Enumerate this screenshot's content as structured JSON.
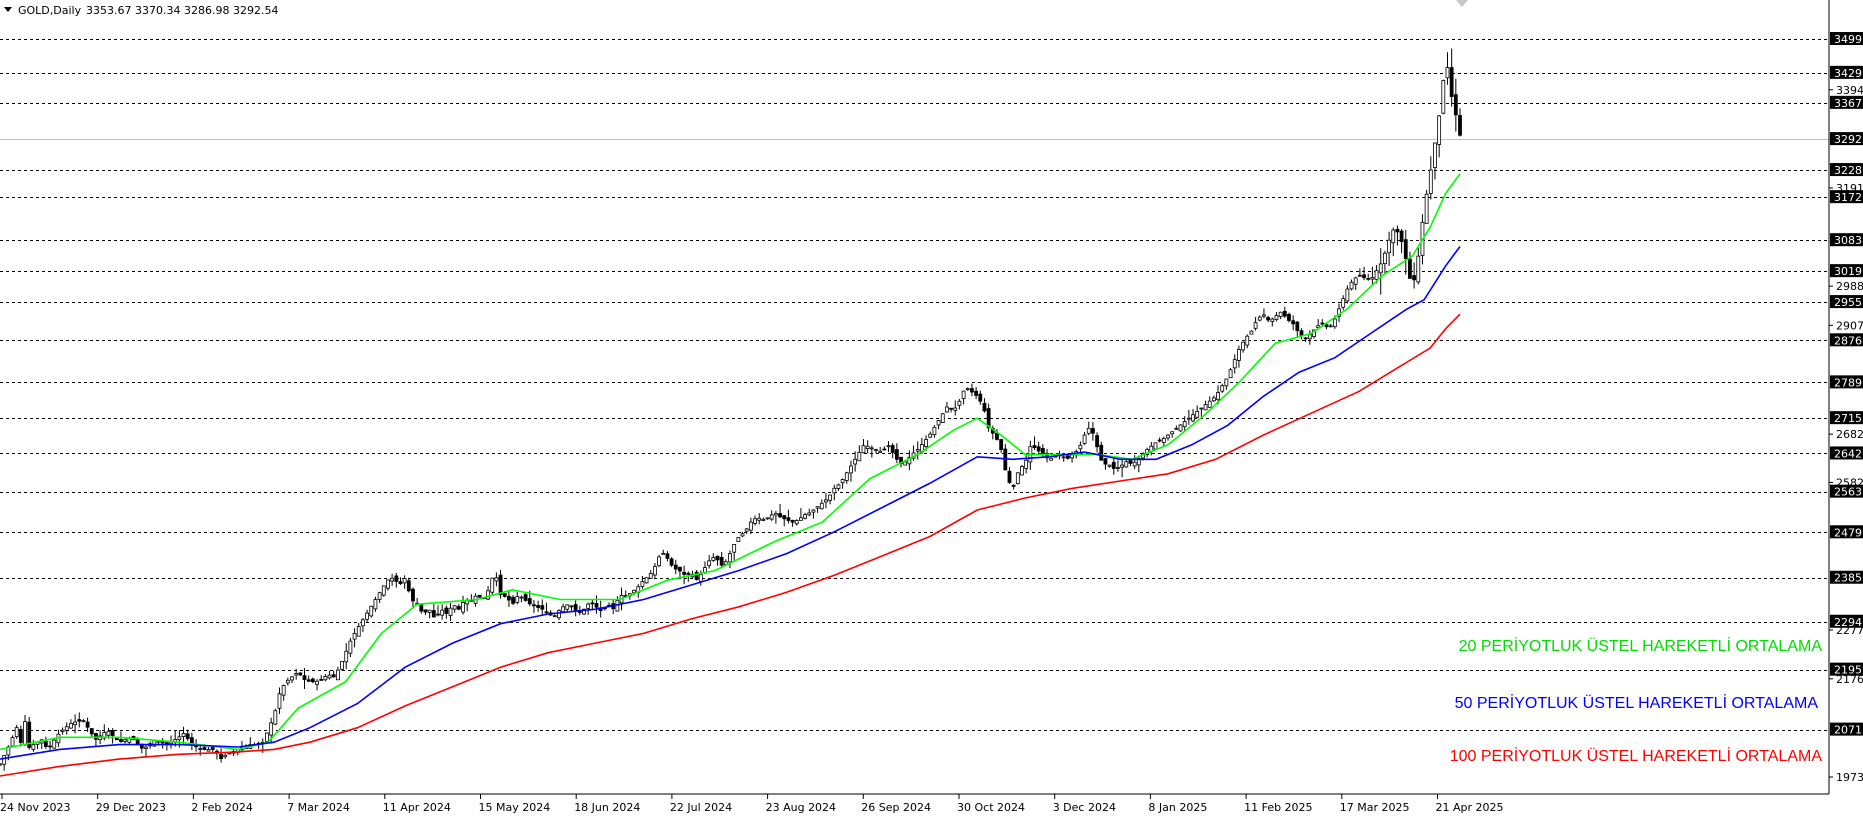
{
  "header": {
    "symbol": "GOLD,Daily",
    "ohlc": "3353.67 3370.34 3286.98 3292.54"
  },
  "chart_data": {
    "type": "candlestick",
    "title": "GOLD,Daily",
    "ylim": [
      1940,
      3510
    ],
    "price_axis_ticks": [
      "3499",
      "3429",
      "3394",
      "3367",
      "3292",
      "3228",
      "3191",
      "3172",
      "3083",
      "3019",
      "2988",
      "2955",
      "2907",
      "2876",
      "2789",
      "2715",
      "2682",
      "2642",
      "2582",
      "2563",
      "2479",
      "2385",
      "2294",
      "2277",
      "2195",
      "2176",
      "2071",
      "1973"
    ],
    "highlighted_levels": [
      "3499",
      "3429",
      "3367",
      "3292",
      "3228",
      "3172",
      "3083",
      "3019",
      "2955",
      "2876",
      "2789",
      "2715",
      "2642",
      "2563",
      "2479",
      "2385",
      "2294",
      "2195",
      "2071"
    ],
    "current_price": "3292",
    "x_tick_labels": [
      "24 Nov 2023",
      "29 Dec 2023",
      "2 Feb 2024",
      "7 Mar 2024",
      "11 Apr 2024",
      "15 May 2024",
      "18 Jun 2024",
      "22 Jul 2024",
      "23 Aug 2024",
      "26 Sep 2024",
      "30 Oct 2024",
      "3 Dec 2024",
      "8 Jan 2025",
      "11 Feb 2025",
      "17 Mar 2025",
      "21 Apr 2025"
    ],
    "price_path": [
      [
        0,
        2000
      ],
      [
        8,
        2040
      ],
      [
        14,
        2075
      ],
      [
        18,
        2040
      ],
      [
        20,
        2145
      ],
      [
        22,
        2030
      ],
      [
        28,
        2040
      ],
      [
        35,
        2050
      ],
      [
        40,
        2030
      ],
      [
        50,
        2065
      ],
      [
        60,
        2085
      ],
      [
        70,
        2090
      ],
      [
        80,
        2050
      ],
      [
        90,
        2070
      ],
      [
        100,
        2045
      ],
      [
        110,
        2055
      ],
      [
        120,
        2030
      ],
      [
        130,
        2050
      ],
      [
        140,
        2040
      ],
      [
        150,
        2055
      ],
      [
        155,
        2065
      ],
      [
        160,
        2040
      ],
      [
        170,
        2030
      ],
      [
        180,
        2030
      ],
      [
        185,
        2010
      ],
      [
        190,
        2020
      ],
      [
        200,
        2030
      ],
      [
        210,
        2040
      ],
      [
        220,
        2040
      ],
      [
        225,
        2070
      ],
      [
        230,
        2100
      ],
      [
        235,
        2150
      ],
      [
        240,
        2170
      ],
      [
        245,
        2180
      ],
      [
        250,
        2190
      ],
      [
        255,
        2175
      ],
      [
        260,
        2170
      ],
      [
        265,
        2170
      ],
      [
        270,
        2175
      ],
      [
        275,
        2185
      ],
      [
        280,
        2180
      ],
      [
        285,
        2200
      ],
      [
        290,
        2230
      ],
      [
        295,
        2260
      ],
      [
        300,
        2280
      ],
      [
        305,
        2300
      ],
      [
        310,
        2320
      ],
      [
        315,
        2340
      ],
      [
        320,
        2360
      ],
      [
        325,
        2380
      ],
      [
        330,
        2385
      ],
      [
        335,
        2370
      ],
      [
        340,
        2385
      ],
      [
        345,
        2340
      ],
      [
        350,
        2330
      ],
      [
        355,
        2310
      ],
      [
        360,
        2320
      ],
      [
        365,
        2300
      ],
      [
        370,
        2320
      ],
      [
        375,
        2310
      ],
      [
        380,
        2330
      ],
      [
        385,
        2320
      ],
      [
        390,
        2340
      ],
      [
        395,
        2335
      ],
      [
        400,
        2350
      ],
      [
        405,
        2340
      ],
      [
        410,
        2360
      ],
      [
        415,
        2400
      ],
      [
        420,
        2350
      ],
      [
        425,
        2345
      ],
      [
        430,
        2330
      ],
      [
        435,
        2350
      ],
      [
        440,
        2340
      ],
      [
        445,
        2330
      ],
      [
        450,
        2325
      ],
      [
        455,
        2320
      ],
      [
        460,
        2310
      ],
      [
        465,
        2305
      ],
      [
        470,
        2320
      ],
      [
        475,
        2330
      ],
      [
        480,
        2325
      ],
      [
        485,
        2310
      ],
      [
        490,
        2320
      ],
      [
        495,
        2335
      ],
      [
        500,
        2325
      ],
      [
        505,
        2315
      ],
      [
        510,
        2330
      ],
      [
        515,
        2320
      ],
      [
        520,
        2350
      ],
      [
        525,
        2345
      ],
      [
        530,
        2355
      ],
      [
        535,
        2365
      ],
      [
        540,
        2380
      ],
      [
        545,
        2390
      ],
      [
        550,
        2410
      ],
      [
        555,
        2440
      ],
      [
        560,
        2425
      ],
      [
        565,
        2405
      ],
      [
        570,
        2400
      ],
      [
        575,
        2390
      ],
      [
        580,
        2395
      ],
      [
        585,
        2380
      ],
      [
        590,
        2400
      ],
      [
        595,
        2420
      ],
      [
        600,
        2430
      ],
      [
        605,
        2410
      ],
      [
        610,
        2420
      ],
      [
        615,
        2450
      ],
      [
        620,
        2470
      ],
      [
        625,
        2480
      ],
      [
        630,
        2500
      ],
      [
        635,
        2510
      ],
      [
        640,
        2505
      ],
      [
        645,
        2510
      ],
      [
        650,
        2520
      ],
      [
        655,
        2510
      ],
      [
        660,
        2505
      ],
      [
        665,
        2500
      ],
      [
        670,
        2505
      ],
      [
        675,
        2515
      ],
      [
        680,
        2520
      ],
      [
        685,
        2530
      ],
      [
        690,
        2540
      ],
      [
        695,
        2550
      ],
      [
        700,
        2570
      ],
      [
        705,
        2580
      ],
      [
        710,
        2600
      ],
      [
        715,
        2620
      ],
      [
        720,
        2640
      ],
      [
        725,
        2660
      ],
      [
        730,
        2655
      ],
      [
        735,
        2650
      ],
      [
        740,
        2645
      ],
      [
        745,
        2660
      ],
      [
        750,
        2640
      ],
      [
        755,
        2620
      ],
      [
        760,
        2625
      ],
      [
        765,
        2640
      ],
      [
        770,
        2650
      ],
      [
        775,
        2665
      ],
      [
        780,
        2680
      ],
      [
        785,
        2700
      ],
      [
        790,
        2720
      ],
      [
        795,
        2740
      ],
      [
        800,
        2730
      ],
      [
        805,
        2750
      ],
      [
        810,
        2780
      ],
      [
        815,
        2770
      ],
      [
        820,
        2760
      ],
      [
        825,
        2740
      ],
      [
        830,
        2690
      ],
      [
        835,
        2680
      ],
      [
        840,
        2650
      ],
      [
        845,
        2590
      ],
      [
        850,
        2570
      ],
      [
        855,
        2610
      ],
      [
        860,
        2620
      ],
      [
        865,
        2660
      ],
      [
        870,
        2650
      ],
      [
        875,
        2640
      ],
      [
        880,
        2630
      ],
      [
        885,
        2635
      ],
      [
        890,
        2640
      ],
      [
        895,
        2630
      ],
      [
        900,
        2640
      ],
      [
        905,
        2650
      ],
      [
        910,
        2680
      ],
      [
        915,
        2700
      ],
      [
        920,
        2660
      ],
      [
        925,
        2620
      ],
      [
        930,
        2620
      ],
      [
        935,
        2610
      ],
      [
        940,
        2615
      ],
      [
        945,
        2625
      ],
      [
        950,
        2620
      ],
      [
        955,
        2630
      ],
      [
        960,
        2645
      ],
      [
        965,
        2655
      ],
      [
        970,
        2665
      ],
      [
        975,
        2670
      ],
      [
        980,
        2680
      ],
      [
        985,
        2690
      ],
      [
        990,
        2700
      ],
      [
        995,
        2710
      ],
      [
        1000,
        2720
      ],
      [
        1005,
        2730
      ],
      [
        1010,
        2740
      ],
      [
        1015,
        2750
      ],
      [
        1020,
        2760
      ],
      [
        1025,
        2780
      ],
      [
        1030,
        2800
      ],
      [
        1035,
        2830
      ],
      [
        1040,
        2860
      ],
      [
        1045,
        2880
      ],
      [
        1050,
        2895
      ],
      [
        1055,
        2920
      ],
      [
        1060,
        2930
      ],
      [
        1065,
        2915
      ],
      [
        1070,
        2925
      ],
      [
        1075,
        2935
      ],
      [
        1080,
        2920
      ],
      [
        1085,
        2910
      ],
      [
        1090,
        2890
      ],
      [
        1095,
        2880
      ],
      [
        1100,
        2890
      ],
      [
        1105,
        2905
      ],
      [
        1110,
        2910
      ],
      [
        1115,
        2900
      ],
      [
        1120,
        2920
      ],
      [
        1125,
        2950
      ],
      [
        1130,
        2980
      ],
      [
        1135,
        3000
      ],
      [
        1140,
        3010
      ],
      [
        1145,
        3005
      ],
      [
        1150,
        3000
      ],
      [
        1155,
        3020
      ],
      [
        1160,
        3040
      ],
      [
        1165,
        3080
      ],
      [
        1170,
        3110
      ],
      [
        1175,
        3090
      ],
      [
        1180,
        3040
      ],
      [
        1185,
        2980
      ],
      [
        1190,
        3050
      ],
      [
        1195,
        3150
      ],
      [
        1200,
        3220
      ],
      [
        1205,
        3300
      ],
      [
        1210,
        3380
      ],
      [
        1213,
        3480
      ],
      [
        1216,
        3400
      ],
      [
        1220,
        3360
      ],
      [
        1225,
        3300
      ]
    ],
    "ema_20_path": [
      [
        0,
        2030
      ],
      [
        50,
        2055
      ],
      [
        100,
        2055
      ],
      [
        150,
        2045
      ],
      [
        200,
        2030
      ],
      [
        225,
        2045
      ],
      [
        250,
        2115
      ],
      [
        290,
        2170
      ],
      [
        320,
        2270
      ],
      [
        350,
        2330
      ],
      [
        400,
        2340
      ],
      [
        430,
        2360
      ],
      [
        470,
        2340
      ],
      [
        520,
        2340
      ],
      [
        560,
        2380
      ],
      [
        600,
        2400
      ],
      [
        650,
        2460
      ],
      [
        690,
        2500
      ],
      [
        730,
        2590
      ],
      [
        770,
        2640
      ],
      [
        800,
        2690
      ],
      [
        820,
        2715
      ],
      [
        840,
        2680
      ],
      [
        860,
        2640
      ],
      [
        890,
        2640
      ],
      [
        920,
        2640
      ],
      [
        950,
        2630
      ],
      [
        980,
        2660
      ],
      [
        1010,
        2720
      ],
      [
        1040,
        2790
      ],
      [
        1070,
        2870
      ],
      [
        1100,
        2890
      ],
      [
        1130,
        2940
      ],
      [
        1160,
        3010
      ],
      [
        1185,
        3050
      ],
      [
        1200,
        3110
      ],
      [
        1213,
        3180
      ],
      [
        1225,
        3220
      ]
    ],
    "ema_50_path": [
      [
        0,
        2010
      ],
      [
        50,
        2030
      ],
      [
        100,
        2040
      ],
      [
        150,
        2040
      ],
      [
        200,
        2035
      ],
      [
        230,
        2045
      ],
      [
        260,
        2075
      ],
      [
        300,
        2125
      ],
      [
        340,
        2200
      ],
      [
        380,
        2250
      ],
      [
        420,
        2290
      ],
      [
        460,
        2310
      ],
      [
        500,
        2320
      ],
      [
        540,
        2340
      ],
      [
        580,
        2370
      ],
      [
        620,
        2400
      ],
      [
        660,
        2435
      ],
      [
        700,
        2480
      ],
      [
        740,
        2530
      ],
      [
        780,
        2580
      ],
      [
        820,
        2635
      ],
      [
        850,
        2630
      ],
      [
        880,
        2635
      ],
      [
        910,
        2645
      ],
      [
        940,
        2630
      ],
      [
        970,
        2630
      ],
      [
        1000,
        2660
      ],
      [
        1030,
        2700
      ],
      [
        1060,
        2760
      ],
      [
        1090,
        2810
      ],
      [
        1120,
        2840
      ],
      [
        1150,
        2890
      ],
      [
        1180,
        2940
      ],
      [
        1195,
        2960
      ],
      [
        1213,
        3030
      ],
      [
        1225,
        3070
      ]
    ],
    "ema_100_path": [
      [
        0,
        1975
      ],
      [
        50,
        1995
      ],
      [
        100,
        2010
      ],
      [
        150,
        2020
      ],
      [
        200,
        2025
      ],
      [
        230,
        2030
      ],
      [
        260,
        2045
      ],
      [
        300,
        2075
      ],
      [
        340,
        2120
      ],
      [
        380,
        2160
      ],
      [
        420,
        2200
      ],
      [
        460,
        2230
      ],
      [
        500,
        2250
      ],
      [
        540,
        2270
      ],
      [
        580,
        2300
      ],
      [
        620,
        2325
      ],
      [
        660,
        2355
      ],
      [
        700,
        2390
      ],
      [
        740,
        2430
      ],
      [
        780,
        2470
      ],
      [
        820,
        2525
      ],
      [
        860,
        2550
      ],
      [
        900,
        2570
      ],
      [
        940,
        2585
      ],
      [
        980,
        2600
      ],
      [
        1020,
        2630
      ],
      [
        1060,
        2680
      ],
      [
        1100,
        2725
      ],
      [
        1140,
        2770
      ],
      [
        1180,
        2830
      ],
      [
        1200,
        2860
      ],
      [
        1213,
        2900
      ],
      [
        1225,
        2930
      ]
    ],
    "series": [
      {
        "name": "20 PERİYOTLUK ÜSTEL HAREKETLİ ORTALAMA",
        "color": "#00ff00"
      },
      {
        "name": "50 PERİYOTLUK ÜSTEL HAREKETLİ ORTALAMA",
        "color": "#0000ff"
      },
      {
        "name": "100 PERİYOTLUK ÜSTEL HAREKETLİ ORTALAMA",
        "color": "#ff0000"
      }
    ]
  }
}
